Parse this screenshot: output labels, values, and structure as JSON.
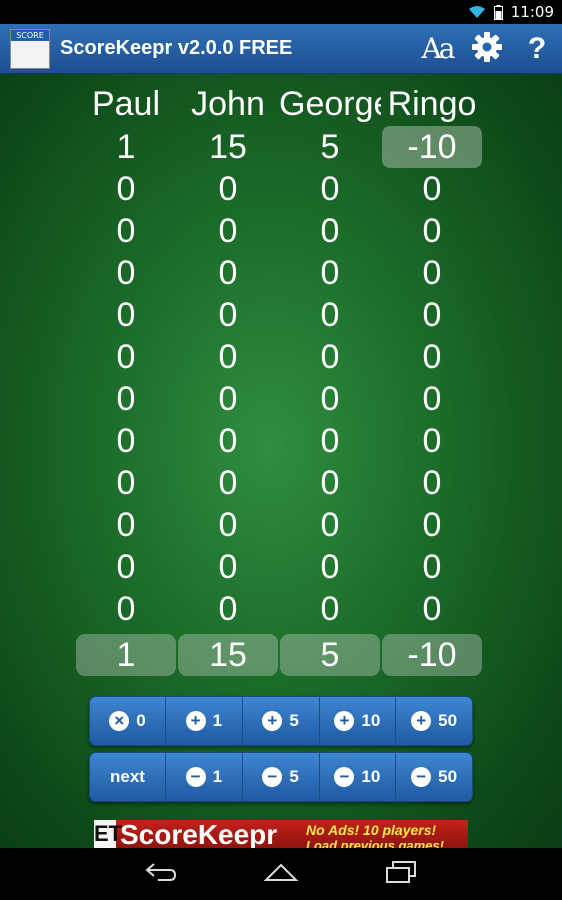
{
  "status_bar": {
    "time": "11:09"
  },
  "action_bar": {
    "logo_text": "SCORE",
    "title": "ScoreKeepr v2.0.0 FREE",
    "font_icon_label": "Aa",
    "help_icon_label": "?"
  },
  "players": [
    "Paul",
    "John",
    "George",
    "Ringo"
  ],
  "scores": [
    [
      "1",
      "15",
      "5",
      "-10"
    ],
    [
      "0",
      "0",
      "0",
      "0"
    ],
    [
      "0",
      "0",
      "0",
      "0"
    ],
    [
      "0",
      "0",
      "0",
      "0"
    ],
    [
      "0",
      "0",
      "0",
      "0"
    ],
    [
      "0",
      "0",
      "0",
      "0"
    ],
    [
      "0",
      "0",
      "0",
      "0"
    ],
    [
      "0",
      "0",
      "0",
      "0"
    ],
    [
      "0",
      "0",
      "0",
      "0"
    ],
    [
      "0",
      "0",
      "0",
      "0"
    ],
    [
      "0",
      "0",
      "0",
      "0"
    ],
    [
      "0",
      "0",
      "0",
      "0"
    ]
  ],
  "selected_cell": {
    "row": 0,
    "col": 3
  },
  "totals": [
    "1",
    "15",
    "5",
    "-10"
  ],
  "add_bar": [
    {
      "icon": "×",
      "label": "0",
      "name": "reset-button"
    },
    {
      "icon": "+",
      "label": "1",
      "name": "plus-1-button"
    },
    {
      "icon": "+",
      "label": "5",
      "name": "plus-5-button"
    },
    {
      "icon": "+",
      "label": "10",
      "name": "plus-10-button"
    },
    {
      "icon": "+",
      "label": "50",
      "name": "plus-50-button"
    }
  ],
  "sub_bar": [
    {
      "icon": "",
      "label": "next",
      "name": "next-button"
    },
    {
      "icon": "−",
      "label": "1",
      "name": "minus-1-button"
    },
    {
      "icon": "−",
      "label": "5",
      "name": "minus-5-button"
    },
    {
      "icon": "−",
      "label": "10",
      "name": "minus-10-button"
    },
    {
      "icon": "−",
      "label": "50",
      "name": "minus-50-button"
    }
  ],
  "ad": {
    "prefix": "ET",
    "brand": "ScoreKeepr",
    "tagline": "No Ads!  10 players!",
    "tagline2": "Load previous games!"
  },
  "colors": {
    "action_bar": "#2f6fb6",
    "board": "#1c6d2a",
    "buttons": "#2f72bd",
    "ad": "#c2221a"
  }
}
